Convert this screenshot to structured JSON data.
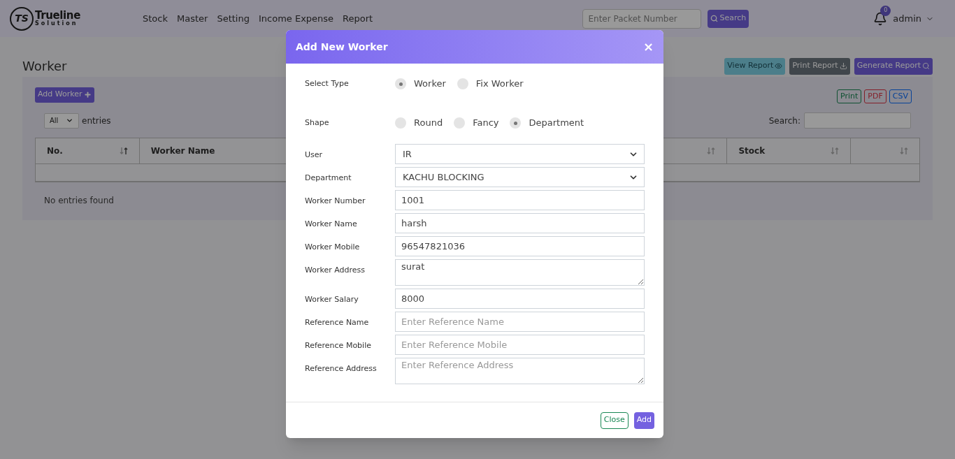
{
  "logo": {
    "mark": "TS",
    "name": "Trueline",
    "tagline": "Solution"
  },
  "nav": [
    "Stock",
    "Master",
    "Setting",
    "Income Expense",
    "Report"
  ],
  "packet_search": {
    "placeholder": "Enter Packet Number",
    "button": "Search"
  },
  "notifications": {
    "count": "0"
  },
  "user": {
    "name": "admin"
  },
  "page": {
    "title": "Worker"
  },
  "report_buttons": [
    {
      "label": "View Report",
      "kind": "view"
    },
    {
      "label": "Print Report",
      "kind": "print"
    },
    {
      "label": "Generate Report",
      "kind": "generate"
    }
  ],
  "add_button": "Add Worker",
  "export_buttons": [
    {
      "label": "Print",
      "kind": "print"
    },
    {
      "label": "PDF",
      "kind": "pdf"
    },
    {
      "label": "CSV",
      "kind": "csv"
    }
  ],
  "length": {
    "value": "All",
    "label": "entries"
  },
  "table_search": {
    "label": "Search:"
  },
  "table": {
    "columns": [
      {
        "label": "No.",
        "sorted": true
      },
      {
        "label": "Worker Name"
      },
      {
        "sorted": false
      },
      {
        "label": "Stock",
        "sorted": false
      },
      {
        "sorted": false
      }
    ],
    "empty_message": "No entries found"
  },
  "modal": {
    "title": "Add New Worker",
    "close": "×",
    "fields": [
      {
        "kind": "radio",
        "label": "Select Type",
        "options": [
          {
            "label": "Worker",
            "selected": true
          },
          {
            "label": "Fix Worker",
            "selected": false
          }
        ]
      },
      {
        "kind": "radio",
        "label": "Shape",
        "options": [
          {
            "label": "Round",
            "selected": false
          },
          {
            "label": "Fancy",
            "selected": false
          },
          {
            "label": "Department",
            "selected": true
          }
        ]
      },
      {
        "kind": "select",
        "label": "User",
        "value": "IR"
      },
      {
        "kind": "select",
        "label": "Department",
        "value": "KACHU BLOCKING"
      },
      {
        "kind": "input",
        "label": "Worker Number",
        "value": "1001"
      },
      {
        "kind": "input",
        "label": "Worker Name",
        "value": "harsh"
      },
      {
        "kind": "input",
        "label": "Worker Mobile",
        "value": "96547821036"
      },
      {
        "kind": "textarea",
        "label": "Worker Address",
        "value": "surat"
      },
      {
        "kind": "input",
        "label": "Worker Salary",
        "value": "8000"
      },
      {
        "kind": "input",
        "label": "Reference Name",
        "placeholder": "Enter Reference Name"
      },
      {
        "kind": "input",
        "label": "Reference Mobile",
        "placeholder": "Enter Reference Mobile"
      },
      {
        "kind": "textarea",
        "label": "Reference Address",
        "placeholder": "Enter Reference Address"
      }
    ],
    "buttons": [
      {
        "label": "Close",
        "kind": "outline"
      },
      {
        "label": "Add",
        "kind": "primary"
      }
    ]
  }
}
